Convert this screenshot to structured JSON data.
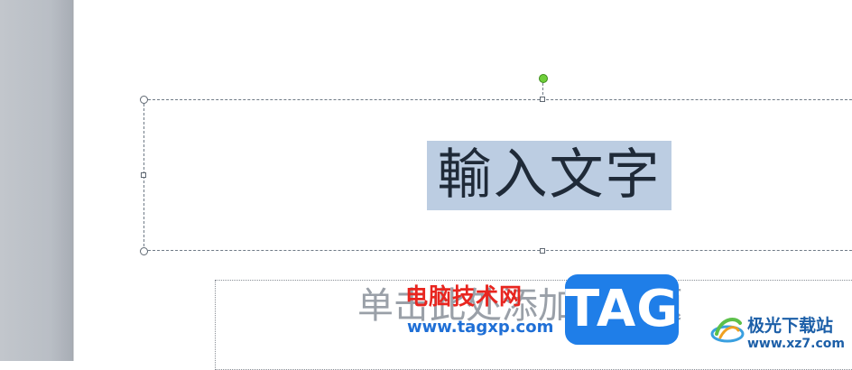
{
  "slide": {
    "title_text": "輸入文字",
    "subtitle_placeholder": "单击此处添加副标题"
  },
  "watermarks": {
    "brand_cn": "电脑技术网",
    "brand_url": "www.tagxp.com",
    "tag_logo": "TAG",
    "site_cn": "极光下载站",
    "site_url": "www.xz7.com"
  },
  "colors": {
    "selection_highlight": "#bccde2",
    "rotate_handle": "#6fcf3a",
    "brand_red": "#e8251f",
    "brand_blue": "#1f7ee8"
  },
  "icons": {
    "rotate_handle": "rotate-handle-icon",
    "site_logo": "aurora-logo-icon"
  }
}
